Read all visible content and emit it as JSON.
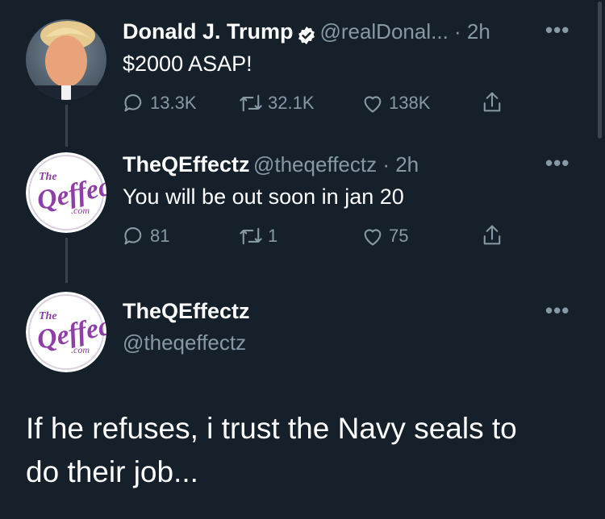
{
  "tweet1": {
    "name": "Donald J. Trump",
    "handle_time": "@realDonal... · 2h",
    "text": "$2000 ASAP!",
    "replies": "13.3K",
    "retweets": "32.1K",
    "likes": "138K"
  },
  "tweet2": {
    "name": "TheQEffectz",
    "handle_time": "@theqeffectz · 2h",
    "text": "You will be out soon in jan 20",
    "replies": "81",
    "retweets": "1",
    "likes": "75"
  },
  "tweet3": {
    "name": "TheQEffectz",
    "handle": "@theqeffectz",
    "text_line1": "If he refuses, i trust the Navy seals to",
    "text_line2": "do their job..."
  },
  "more_label": "•••",
  "logo": {
    "letters": "The Qeffectz .com",
    "color": "#8e3fa6"
  },
  "colors": {
    "background": "#15202b",
    "muted": "#8899a6",
    "verified": "#ffffff"
  }
}
